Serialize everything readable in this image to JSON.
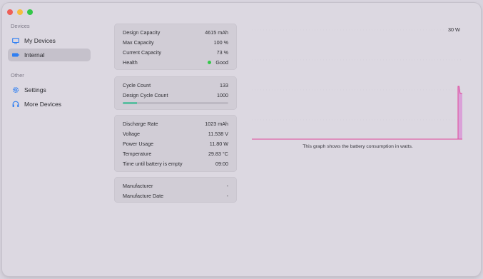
{
  "sidebar": {
    "section_devices": "Devices",
    "section_other": "Other",
    "items": [
      {
        "label": "My Devices",
        "icon": "display-icon"
      },
      {
        "label": "Internal",
        "icon": "battery-icon"
      },
      {
        "label": "Settings",
        "icon": "gear-icon"
      },
      {
        "label": "More Devices",
        "icon": "headphones-icon"
      }
    ]
  },
  "capacity": {
    "design_capacity": {
      "label": "Design Capacity",
      "value": "4615 mAh"
    },
    "max_capacity": {
      "label": "Max Capacity",
      "value": "100 %"
    },
    "current_capacity": {
      "label": "Current Capacity",
      "value": "73 %"
    },
    "health": {
      "label": "Health",
      "value": "Good"
    }
  },
  "cycles": {
    "cycle_count": {
      "label": "Cycle Count",
      "value": "133"
    },
    "design_cycle_count": {
      "label": "Design Cycle Count",
      "value": "1000"
    },
    "progress_fraction": 0.133
  },
  "power": {
    "discharge_rate": {
      "label": "Discharge Rate",
      "value": "1023 mAh"
    },
    "voltage": {
      "label": "Voltage",
      "value": "11.538 V"
    },
    "power_usage": {
      "label": "Power Usage",
      "value": "11.80 W"
    },
    "temperature": {
      "label": "Temperature",
      "value": "29.83 °C"
    },
    "time_until_empty": {
      "label": "Time until battery is empty",
      "value": "09:00"
    }
  },
  "manufacturer": {
    "manufacturer": {
      "label": "Manufacturer",
      "value": "-"
    },
    "manufacture_date": {
      "label": "Manufacture Date",
      "value": "-"
    }
  },
  "graph": {
    "max_label": "30 W",
    "caption": "This graph shows the battery consumption in watts.",
    "colors": {
      "line": "#e0489c",
      "fill": "#d98fd4"
    }
  },
  "colors": {
    "progress_fill": "#5ebea2",
    "health_good": "#34c84a"
  }
}
